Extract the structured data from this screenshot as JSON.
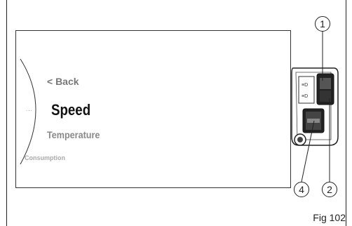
{
  "menu": {
    "back_label": "< Back",
    "selected_label": "Speed",
    "next_label": "Temperature",
    "next2_label": "Consumption",
    "dots": "..."
  },
  "callouts": {
    "c1": "1",
    "c2": "2",
    "c4": "4"
  },
  "caption": "Fig 102"
}
